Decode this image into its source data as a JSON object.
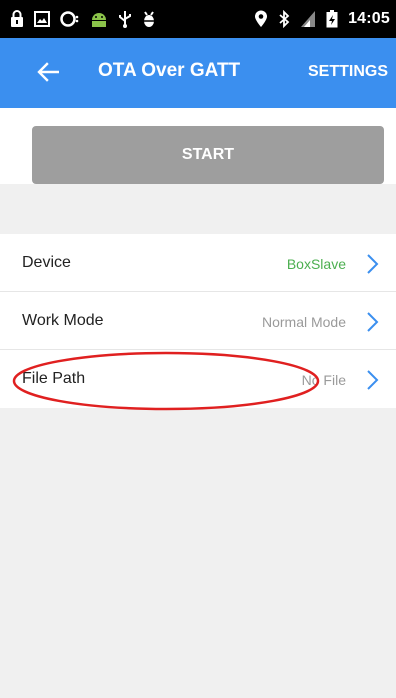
{
  "status_bar": {
    "time": "14:05",
    "icons": [
      "lock-icon",
      "image-icon",
      "chat-icon",
      "android-icon",
      "usb-icon",
      "debug-icon",
      "location-icon",
      "bluetooth-icon",
      "signal-icon",
      "battery-icon"
    ]
  },
  "app_bar": {
    "title": "OTA Over GATT",
    "back_icon": "arrow-left-icon",
    "settings_label": "SETTINGS",
    "color": "#3b8fef"
  },
  "start_button": {
    "label": "START",
    "color": "#9e9e9e"
  },
  "settings_list": [
    {
      "label": "Device",
      "value": "BoxSlave",
      "value_color": "#4caf50"
    },
    {
      "label": "Work Mode",
      "value": "Normal Mode"
    },
    {
      "label": "File Path",
      "value": "No File"
    }
  ],
  "annotation": {
    "shape": "ellipse",
    "color": "#e02020"
  }
}
